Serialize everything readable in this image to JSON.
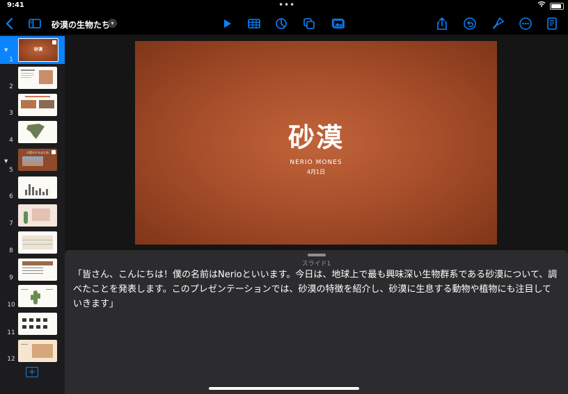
{
  "status": {
    "time": "9:41"
  },
  "toolbar": {
    "document_title": "砂漠の生物たち",
    "icons": [
      "back-icon",
      "sidebar-icon",
      "title-menu-chevron-icon",
      "play-icon",
      "table-icon",
      "chart-icon",
      "shapes-icon",
      "media-icon",
      "share-icon",
      "undo-icon",
      "format-brush-icon",
      "more-icon",
      "presenter-notes-icon"
    ],
    "accent_color": "#0a84ff"
  },
  "navigator": {
    "slides": [
      {
        "number": "1",
        "selected": true,
        "style": "title",
        "mini_title": "砂漠"
      },
      {
        "number": "2",
        "style": "text-photo"
      },
      {
        "number": "3",
        "style": "photos"
      },
      {
        "number": "4",
        "style": "map"
      },
      {
        "number": "5",
        "style": "section",
        "mini_title": "小型モデルまとめ"
      },
      {
        "number": "6",
        "style": "bar-chart"
      },
      {
        "number": "7",
        "style": "cactus"
      },
      {
        "number": "8",
        "style": "table"
      },
      {
        "number": "9",
        "style": "list"
      },
      {
        "number": "10",
        "style": "diagram"
      },
      {
        "number": "11",
        "style": "animals"
      },
      {
        "number": "12",
        "style": "desert-scene"
      }
    ],
    "add_button_icon": "plus-icon"
  },
  "slide": {
    "title": "砂漠",
    "author": "NERIO MONES",
    "date": "4月1日",
    "background_color": "#a94f2b"
  },
  "notes": {
    "label": "スライド1",
    "text": "「皆さん、こんにちは！僕の名前はNerioといいます。今日は、地球上で最も興味深い生物群系である砂漠について、調べたことを発表します。このプレゼンテーションでは、砂漠の特徴を紹介し、砂漠に生息する動物や植物にも注目していきます」"
  }
}
